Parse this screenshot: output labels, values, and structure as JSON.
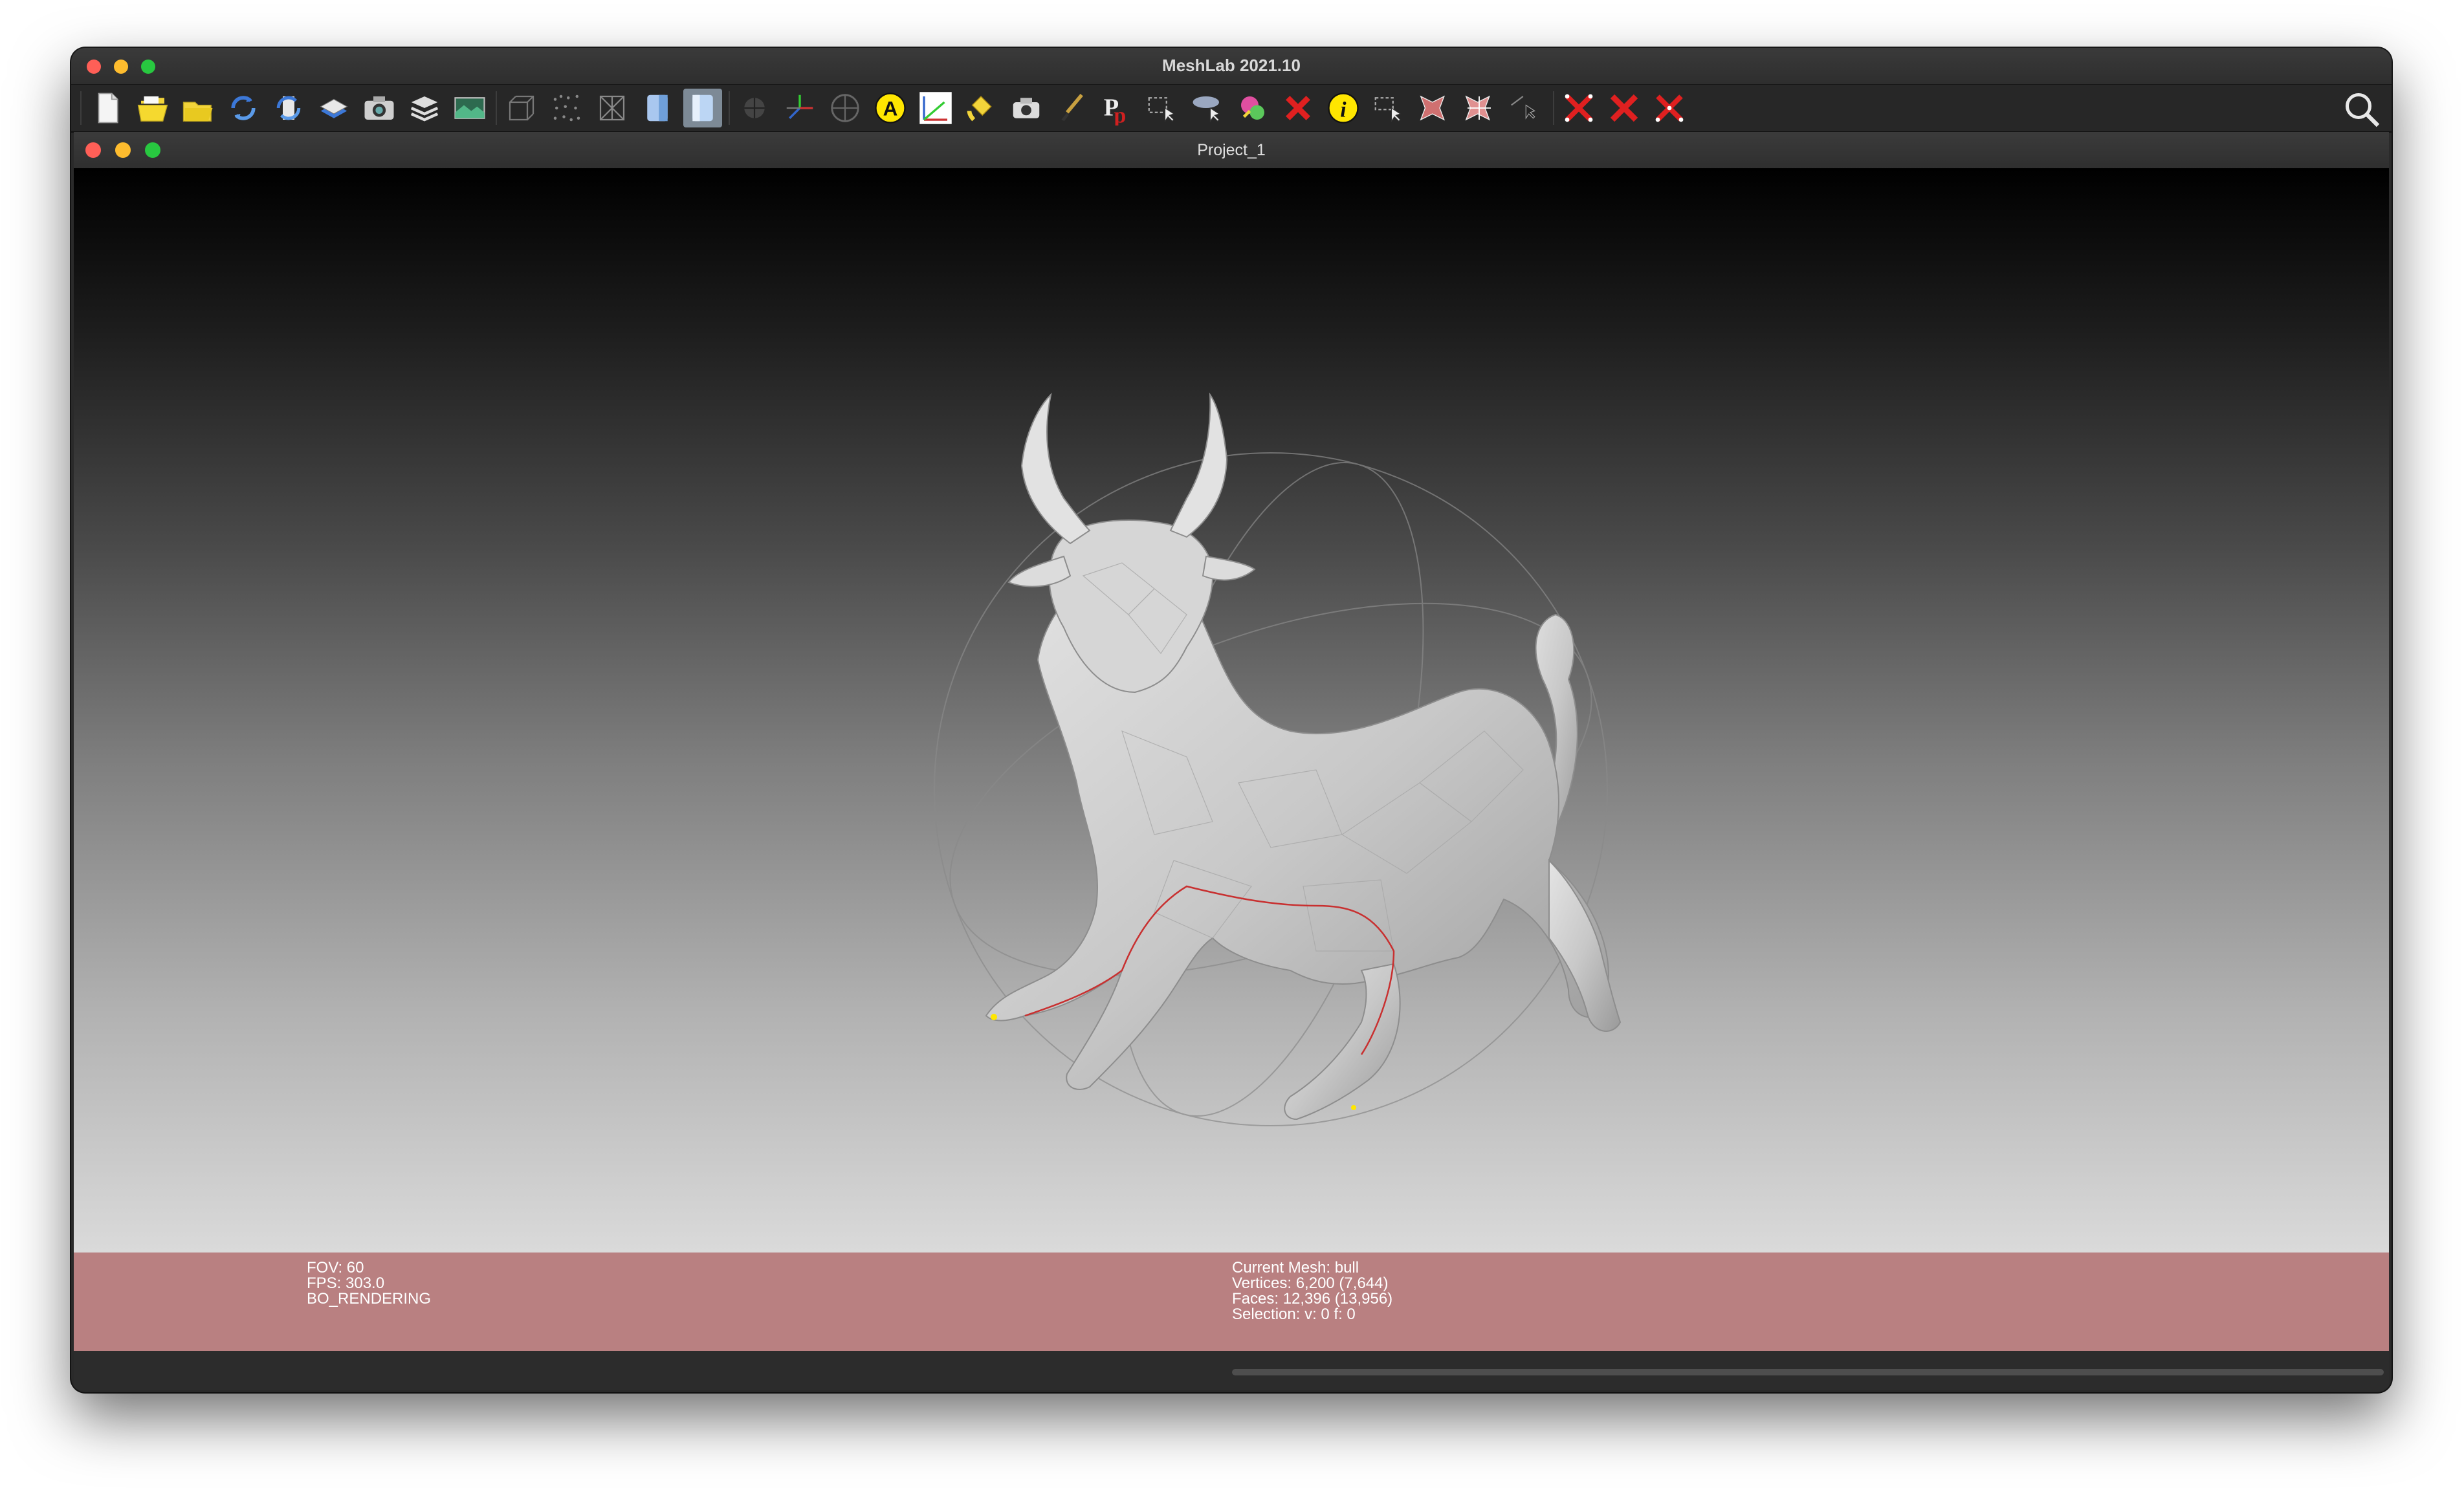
{
  "window": {
    "title": "MeshLab 2021.10"
  },
  "project": {
    "title": "Project_1"
  },
  "toolbar": {
    "items": [
      {
        "icon": "new-project-icon"
      },
      {
        "icon": "open-project-icon"
      },
      {
        "icon": "import-mesh-icon"
      },
      {
        "icon": "reload-icon"
      },
      {
        "icon": "reload-all-icon"
      },
      {
        "icon": "export-mesh-icon"
      },
      {
        "icon": "snapshot-icon"
      },
      {
        "icon": "layers-icon"
      },
      {
        "icon": "raster-icon"
      },
      {
        "icon": "bounding-box-icon"
      },
      {
        "icon": "points-icon"
      },
      {
        "icon": "wireframe-icon"
      },
      {
        "icon": "flat-shading-icon"
      },
      {
        "icon": "smooth-shading-icon"
      },
      {
        "icon": "light-icon"
      },
      {
        "icon": "axes-icon"
      },
      {
        "icon": "trackball-icon"
      },
      {
        "icon": "annotation-a-icon"
      },
      {
        "icon": "measure-tool-icon"
      },
      {
        "icon": "paint-bucket-icon"
      },
      {
        "icon": "camera-icon"
      },
      {
        "icon": "brush-icon"
      },
      {
        "icon": "pickpoints-icon"
      },
      {
        "icon": "select-vertices-icon"
      },
      {
        "icon": "align-icon"
      },
      {
        "icon": "z-paint-icon"
      },
      {
        "icon": "delete-icon"
      },
      {
        "icon": "info-icon"
      },
      {
        "icon": "select-faces-icon"
      },
      {
        "icon": "select-connected-icon"
      },
      {
        "icon": "select-rect-icon"
      },
      {
        "icon": "manipulator-icon"
      },
      {
        "icon": "delete-vertices-icon"
      },
      {
        "icon": "delete-faces-icon"
      },
      {
        "icon": "delete-faces-vertices-icon"
      }
    ],
    "search_icon": "search-icon"
  },
  "viewer": {
    "left_info": {
      "fov": "FOV: 60",
      "fps": "FPS:   303.0",
      "mode": "BO_RENDERING"
    },
    "right_info": {
      "current_mesh": "Current Mesh: bull",
      "vertices": "Vertices: 6,200    (7,644)",
      "faces": "Faces: 12,396    (13,956)",
      "selection": "Selection: v: 0 f: 0"
    }
  },
  "colors": {
    "info_bar": "#b98081",
    "mesh": "#cfcfcf",
    "highlight_edge": "#d03030"
  }
}
